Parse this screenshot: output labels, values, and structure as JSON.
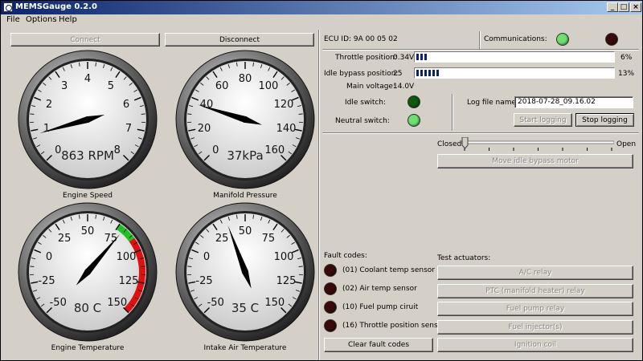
{
  "window": {
    "title": "MEMSGauge 0.2.0"
  },
  "menu": [
    "File",
    "Options",
    "Help"
  ],
  "buttons": {
    "connect": "Connect",
    "disconnect": "Disconnect"
  },
  "ecu_id": "ECU ID: 9A 00 05 02",
  "communications_label": "Communications:",
  "comm_leds": {
    "left": "#6fe06f",
    "right": "#3a0a0a"
  },
  "throttle": {
    "label": "Throttle position:",
    "value": "0.34V",
    "percent_text": "6%",
    "percent": 6
  },
  "idle_bypass": {
    "label": "Idle bypass position:",
    "value": "25",
    "percent_text": "13%",
    "percent": 13
  },
  "main_voltage": {
    "label": "Main voltage:",
    "value": "14.0V"
  },
  "idle_switch": {
    "label": "Idle switch:",
    "color": "#0d5a0d"
  },
  "neutral_switch": {
    "label": "Neutral switch:",
    "color": "#6fe06f"
  },
  "log": {
    "label": "Log file name:",
    "value": "2018-07-28_09.16.02",
    "start": "Start logging",
    "stop": "Stop logging"
  },
  "idle_slider": {
    "closed": "Closed",
    "open": "Open",
    "position": 0.0,
    "move_button": "Move idle bypass motor"
  },
  "gauges": [
    {
      "name": "engine-speed",
      "label": "Engine Speed",
      "reading": "863 RPM",
      "ticks": [
        "0",
        "1",
        "2",
        "3",
        "4",
        "5",
        "6",
        "7",
        "8"
      ],
      "min": 0,
      "max": 8,
      "value": 0.863,
      "redzone": null
    },
    {
      "name": "manifold-pressure",
      "label": "Manifold Pressure",
      "reading": "37kPa",
      "ticks": [
        "0",
        "20",
        "40",
        "60",
        "80",
        "100",
        "120",
        "140",
        "160"
      ],
      "min": 0,
      "max": 160,
      "value": 37,
      "redzone": null
    },
    {
      "name": "engine-temperature",
      "label": "Engine Temperature",
      "reading": "80 C",
      "ticks": [
        "-50",
        "-25",
        "0",
        "25",
        "50",
        "75",
        "100",
        "125",
        "150"
      ],
      "min": -50,
      "max": 150,
      "value": 80,
      "redzone": {
        "green_from": 75,
        "green_to": 90,
        "red_from": 90,
        "red_to": 150
      }
    },
    {
      "name": "intake-air-temperature",
      "label": "Intake Air Temperature",
      "reading": "35 C",
      "ticks": [
        "-50",
        "-25",
        "0",
        "25",
        "50",
        "75",
        "100",
        "125",
        "150"
      ],
      "min": -50,
      "max": 150,
      "value": 35,
      "redzone": null
    }
  ],
  "fault_codes": {
    "label": "Fault codes:",
    "items": [
      {
        "text": "(01) Coolant temp sensor",
        "led": "#3a0a0a"
      },
      {
        "text": "(02) Air temp sensor",
        "led": "#3a0a0a"
      },
      {
        "text": "(10) Fuel pump ciruit",
        "led": "#3a0a0a"
      },
      {
        "text": "(16) Throttle position sensor",
        "led": "#3a0a0a"
      }
    ],
    "clear": "Clear fault codes"
  },
  "actuators": {
    "label": "Test actuators:",
    "items": [
      "A/C relay",
      "PTC (manifold heater) relay",
      "Fuel pump relay",
      "Fuel injector(s)",
      "Ignition coil"
    ]
  }
}
